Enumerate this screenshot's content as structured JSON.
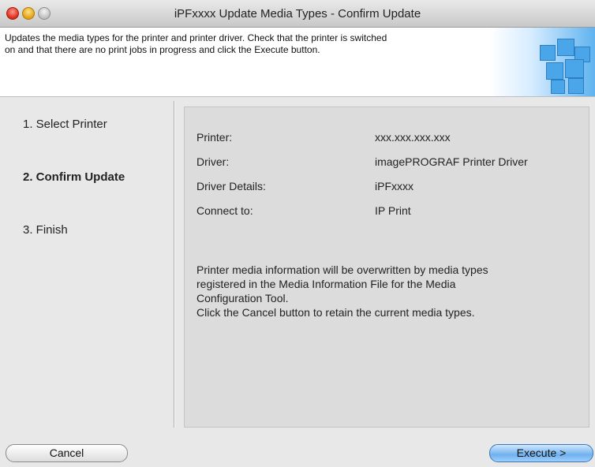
{
  "window": {
    "title": "iPFxxxx Update Media Types - Confirm Update"
  },
  "header": {
    "line1": "Updates the media types for the printer and printer driver. Check that the printer is switched",
    "line2": "on and that there are no print jobs in progress and click the Execute button."
  },
  "steps": [
    {
      "label": "1. Select Printer",
      "active": false
    },
    {
      "label": "2. Confirm Update",
      "active": true
    },
    {
      "label": "3. Finish",
      "active": false
    }
  ],
  "details": [
    {
      "label": "Printer:",
      "value": "xxx.xxx.xxx.xxx"
    },
    {
      "label": "Driver:",
      "value": "imagePROGRAF Printer Driver"
    },
    {
      "label": "Driver Details:",
      "value": "iPFxxxx"
    },
    {
      "label": "Connect to:",
      "value": "IP Print"
    }
  ],
  "message": {
    "line1": "Printer media information will be overwritten by media types",
    "line2": "registered in the Media Information File for the Media",
    "line3": "Configuration Tool.",
    "line4": "Click the Cancel button to retain the current media types."
  },
  "buttons": {
    "cancel": "Cancel",
    "execute": "Execute >"
  }
}
